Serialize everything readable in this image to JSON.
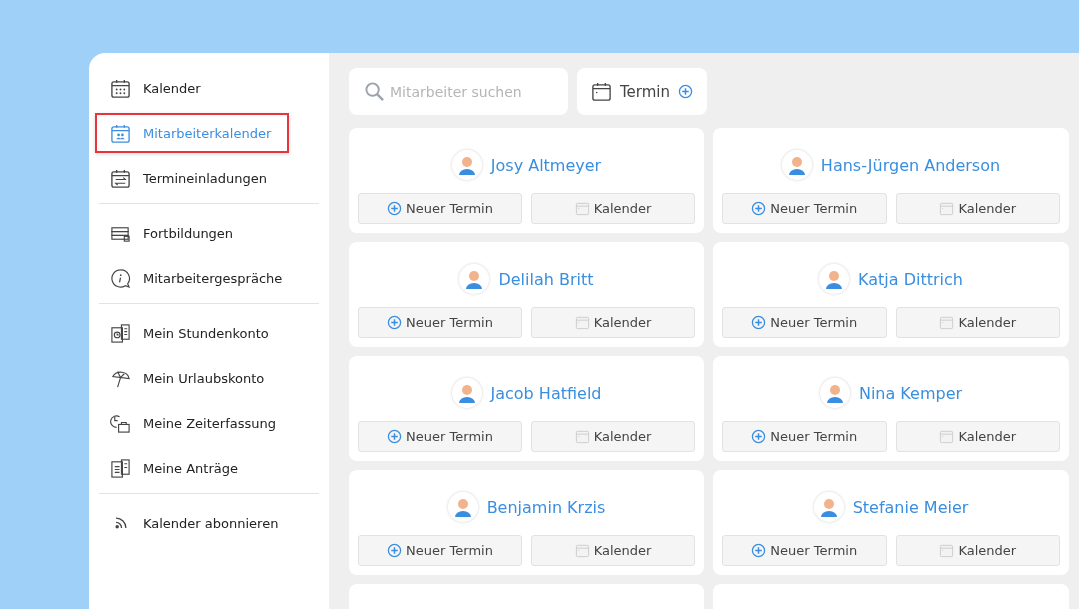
{
  "sidebar": {
    "groups": [
      {
        "items": [
          {
            "kind": "calendar",
            "label": "Kalender",
            "selected": false
          },
          {
            "kind": "team-calendar",
            "label": "Mitarbeiterkalender",
            "selected": true
          },
          {
            "kind": "invitations",
            "label": "Termineinladungen",
            "selected": false
          }
        ]
      },
      {
        "items": [
          {
            "kind": "training",
            "label": "Fortbildungen",
            "selected": false
          },
          {
            "kind": "talk",
            "label": "Mitarbeitergespräche",
            "selected": false
          }
        ]
      },
      {
        "items": [
          {
            "kind": "hours",
            "label": "Mein Stundenkonto",
            "selected": false
          },
          {
            "kind": "vacation",
            "label": "Mein Urlaubskonto",
            "selected": false
          },
          {
            "kind": "time",
            "label": "Meine Zeiterfassung",
            "selected": false
          },
          {
            "kind": "requests",
            "label": "Meine Anträge",
            "selected": false
          }
        ]
      },
      {
        "items": [
          {
            "kind": "subscribe",
            "label": "Kalender abonnieren",
            "selected": false
          }
        ]
      }
    ]
  },
  "search": {
    "placeholder": "Mitarbeiter suchen"
  },
  "new_appointment_button": {
    "label": "Termin"
  },
  "employees": [
    {
      "name": "Josy Altmeyer",
      "new_button": "Neuer Termin",
      "calendar_button": "Kalender"
    },
    {
      "name": "Hans-Jürgen Anderson",
      "new_button": "Neuer Termin",
      "calendar_button": "Kalender"
    },
    {
      "name": "Delilah Britt",
      "new_button": "Neuer Termin",
      "calendar_button": "Kalender"
    },
    {
      "name": "Katja Dittrich",
      "new_button": "Neuer Termin",
      "calendar_button": "Kalender"
    },
    {
      "name": "Jacob Hatfield",
      "new_button": "Neuer Termin",
      "calendar_button": "Kalender"
    },
    {
      "name": "Nina Kemper",
      "new_button": "Neuer Termin",
      "calendar_button": "Kalender"
    },
    {
      "name": "Benjamin Krzis",
      "new_button": "Neuer Termin",
      "calendar_button": "Kalender"
    },
    {
      "name": "Stefanie Meier",
      "new_button": "Neuer Termin",
      "calendar_button": "Kalender"
    }
  ]
}
